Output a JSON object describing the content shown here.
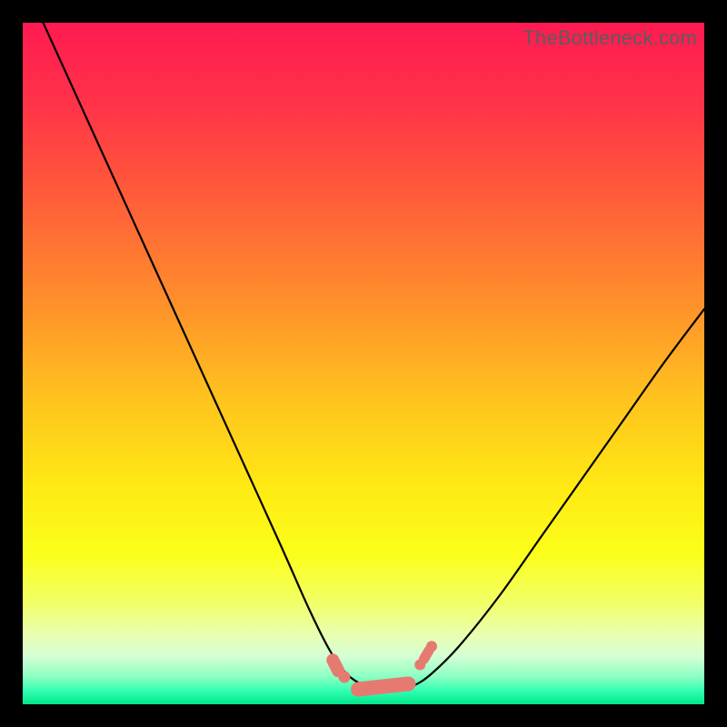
{
  "watermark": "TheBottleneck.com",
  "colors": {
    "frame": "#000000",
    "curve": "#000000",
    "marker": "#e77a70",
    "gradient_stops": [
      {
        "pct": 0,
        "color": "#ff1a52"
      },
      {
        "pct": 12,
        "color": "#ff3348"
      },
      {
        "pct": 25,
        "color": "#ff5b3a"
      },
      {
        "pct": 40,
        "color": "#ff8c2c"
      },
      {
        "pct": 55,
        "color": "#ffc21e"
      },
      {
        "pct": 68,
        "color": "#ffe914"
      },
      {
        "pct": 78,
        "color": "#fbff1a"
      },
      {
        "pct": 85,
        "color": "#f2ff66"
      },
      {
        "pct": 90,
        "color": "#e8ffb3"
      },
      {
        "pct": 93,
        "color": "#d4ffd4"
      },
      {
        "pct": 96,
        "color": "#8affc2"
      },
      {
        "pct": 98,
        "color": "#33ffb3"
      },
      {
        "pct": 100,
        "color": "#00e68a"
      }
    ]
  },
  "chart_data": {
    "type": "line",
    "title": "",
    "xlabel": "",
    "ylabel": "",
    "xlim": [
      0,
      100
    ],
    "ylim": [
      0,
      100
    ],
    "series": [
      {
        "name": "bottleneck-curve",
        "x": [
          3,
          8,
          13,
          18,
          23,
          28,
          33,
          38,
          42,
          45,
          47.5,
          50,
          52.5,
          55,
          57.5,
          60,
          64,
          70,
          76,
          82,
          88,
          94,
          100
        ],
        "y": [
          100,
          89,
          78,
          67,
          56,
          45,
          34,
          23,
          14,
          8,
          4.5,
          2.8,
          2,
          2,
          2.8,
          4.5,
          8.5,
          16,
          24.5,
          33,
          41.5,
          50,
          58
        ]
      }
    ],
    "markers": {
      "name": "highlight-segment",
      "comment": "salmon capsule markers near the curve minimum",
      "x": [
        45.5,
        47.2,
        50.0,
        53.0,
        55.8,
        58.3,
        60.0
      ],
      "y": [
        6.5,
        4.0,
        2.2,
        2.2,
        3.0,
        5.8,
        8.5
      ]
    }
  }
}
